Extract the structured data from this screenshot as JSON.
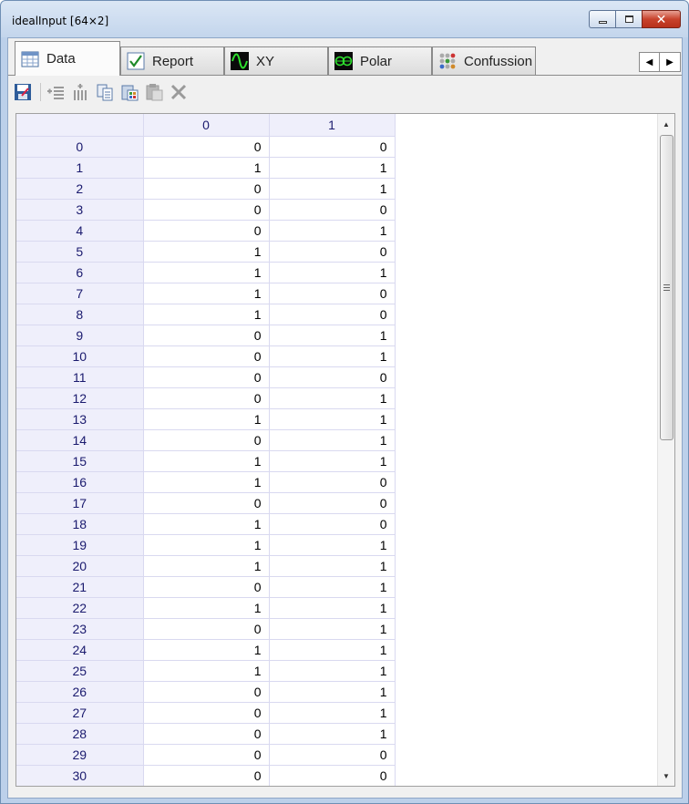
{
  "window": {
    "title": "idealInput [64×2]",
    "controls": {
      "minimize": "minimize",
      "maximize": "maximize",
      "close": "✕"
    }
  },
  "tabs": [
    {
      "label": "Data",
      "icon": "table-icon",
      "active": true
    },
    {
      "label": "Report",
      "icon": "check-icon",
      "active": false
    },
    {
      "label": "XY",
      "icon": "xy-plot-icon",
      "active": false
    },
    {
      "label": "Polar",
      "icon": "polar-plot-icon",
      "active": false
    },
    {
      "label": "Confussion",
      "icon": "confusion-matrix-icon",
      "active": false
    }
  ],
  "tab_scroll": {
    "left": "◀",
    "right": "▶"
  },
  "toolbar": [
    "save-icon",
    "insert-rows-icon",
    "insert-columns-icon",
    "copy-icon",
    "paste-special-icon",
    "paste-icon",
    "delete-icon"
  ],
  "grid": {
    "columns": [
      "0",
      "1"
    ],
    "rows": [
      {
        "index": "0",
        "values": [
          "0",
          "0"
        ]
      },
      {
        "index": "1",
        "values": [
          "1",
          "1"
        ]
      },
      {
        "index": "2",
        "values": [
          "0",
          "1"
        ]
      },
      {
        "index": "3",
        "values": [
          "0",
          "0"
        ]
      },
      {
        "index": "4",
        "values": [
          "0",
          "1"
        ]
      },
      {
        "index": "5",
        "values": [
          "1",
          "0"
        ]
      },
      {
        "index": "6",
        "values": [
          "1",
          "1"
        ]
      },
      {
        "index": "7",
        "values": [
          "1",
          "0"
        ]
      },
      {
        "index": "8",
        "values": [
          "1",
          "0"
        ]
      },
      {
        "index": "9",
        "values": [
          "0",
          "1"
        ]
      },
      {
        "index": "10",
        "values": [
          "0",
          "1"
        ]
      },
      {
        "index": "11",
        "values": [
          "0",
          "0"
        ]
      },
      {
        "index": "12",
        "values": [
          "0",
          "1"
        ]
      },
      {
        "index": "13",
        "values": [
          "1",
          "1"
        ]
      },
      {
        "index": "14",
        "values": [
          "0",
          "1"
        ]
      },
      {
        "index": "15",
        "values": [
          "1",
          "1"
        ]
      },
      {
        "index": "16",
        "values": [
          "1",
          "0"
        ]
      },
      {
        "index": "17",
        "values": [
          "0",
          "0"
        ]
      },
      {
        "index": "18",
        "values": [
          "1",
          "0"
        ]
      },
      {
        "index": "19",
        "values": [
          "1",
          "1"
        ]
      },
      {
        "index": "20",
        "values": [
          "1",
          "1"
        ]
      },
      {
        "index": "21",
        "values": [
          "0",
          "1"
        ]
      },
      {
        "index": "22",
        "values": [
          "1",
          "1"
        ]
      },
      {
        "index": "23",
        "values": [
          "0",
          "1"
        ]
      },
      {
        "index": "24",
        "values": [
          "1",
          "1"
        ]
      },
      {
        "index": "25",
        "values": [
          "1",
          "1"
        ]
      },
      {
        "index": "26",
        "values": [
          "0",
          "1"
        ]
      },
      {
        "index": "27",
        "values": [
          "0",
          "1"
        ]
      },
      {
        "index": "28",
        "values": [
          "0",
          "1"
        ]
      },
      {
        "index": "29",
        "values": [
          "0",
          "0"
        ]
      },
      {
        "index": "30",
        "values": [
          "0",
          "0"
        ]
      },
      {
        "index": "",
        "values": [
          "",
          ""
        ]
      }
    ]
  },
  "colors": {
    "header_bg": "#efeffb",
    "header_text": "#1a1a6e",
    "grid_line": "#d9d9f0",
    "close_button": "#c8432c"
  }
}
